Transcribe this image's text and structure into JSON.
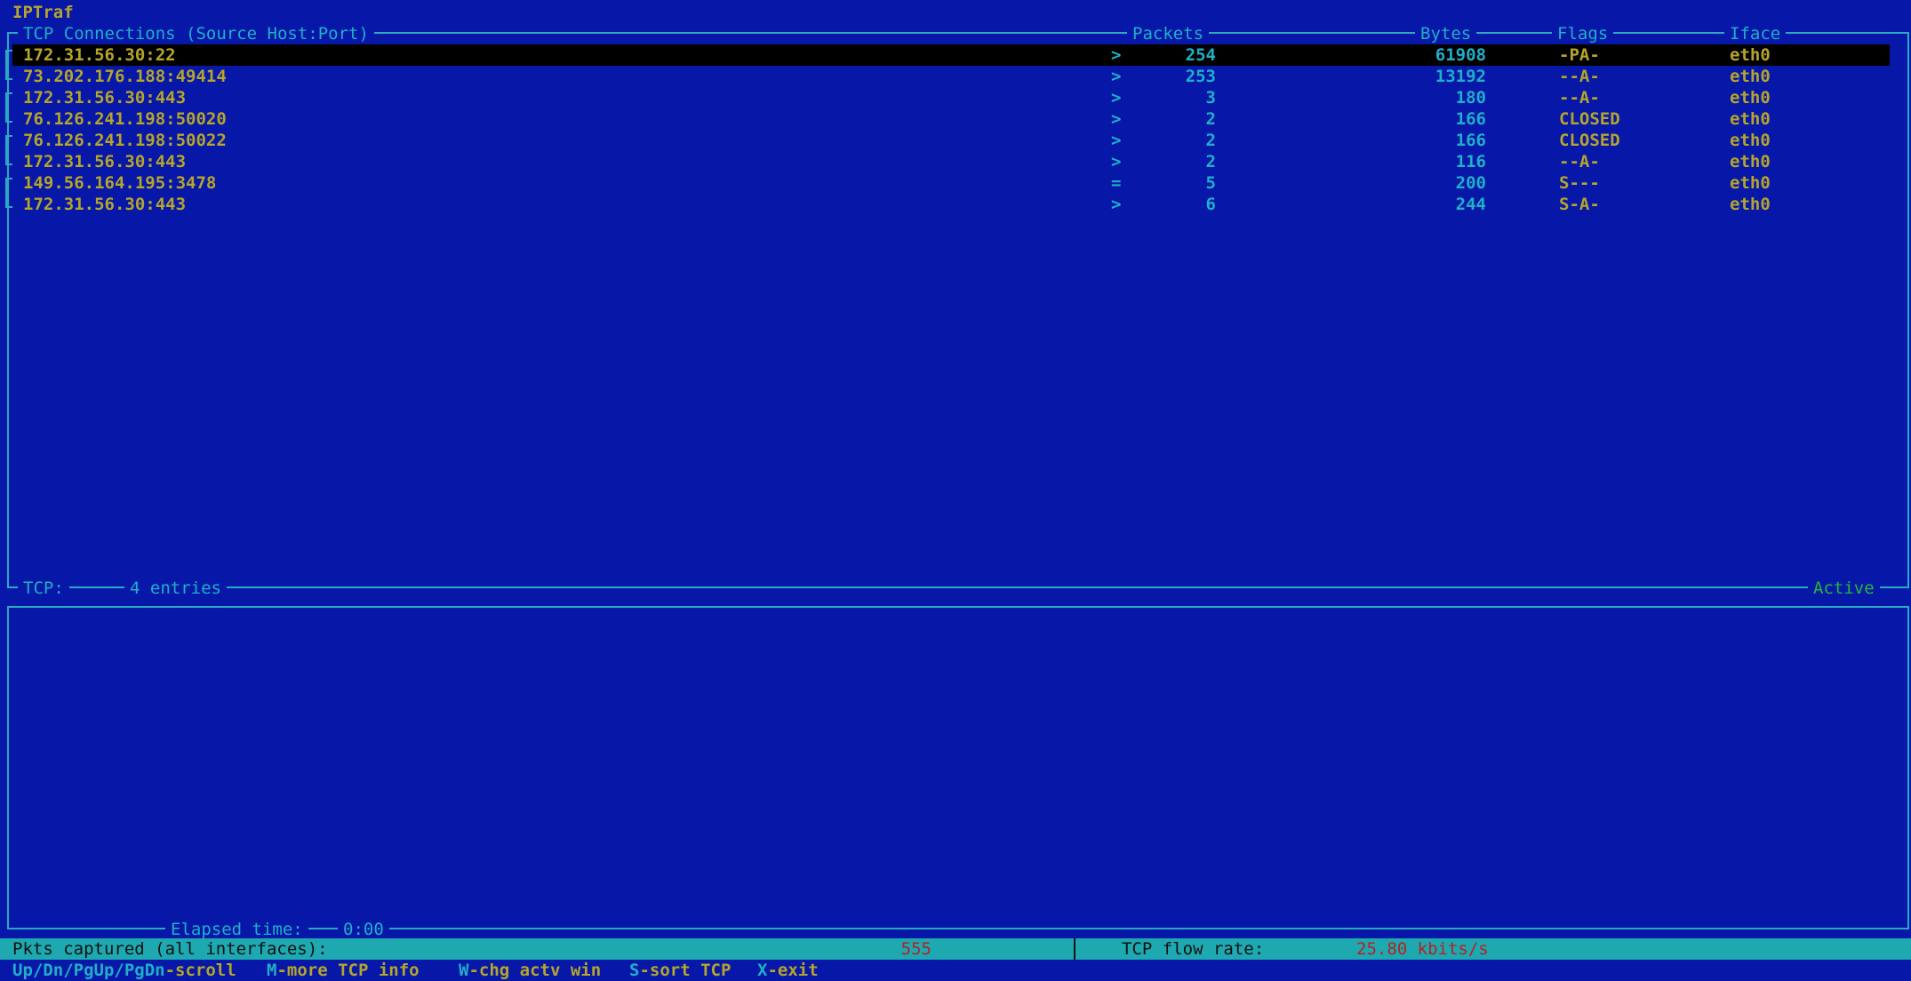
{
  "app": {
    "title": "IPTraf"
  },
  "tcp_window": {
    "title": "TCP Connections (Source Host:Port)",
    "columns": {
      "packets": "Packets",
      "bytes": "Bytes",
      "flags": "Flags",
      "iface": "Iface"
    },
    "rows": [
      {
        "host": "172.31.56.30:22",
        "dir": ">",
        "packets": "254",
        "bytes": "61908",
        "flags": "-PA-",
        "iface": "eth0"
      },
      {
        "host": "73.202.176.188:49414",
        "dir": ">",
        "packets": "253",
        "bytes": "13192",
        "flags": "--A-",
        "iface": "eth0"
      },
      {
        "host": "172.31.56.30:443",
        "dir": ">",
        "packets": "3",
        "bytes": "180",
        "flags": "--A-",
        "iface": "eth0"
      },
      {
        "host": "76.126.241.198:50020",
        "dir": ">",
        "packets": "2",
        "bytes": "166",
        "flags": "CLOSED",
        "iface": "eth0"
      },
      {
        "host": "76.126.241.198:50022",
        "dir": ">",
        "packets": "2",
        "bytes": "166",
        "flags": "CLOSED",
        "iface": "eth0"
      },
      {
        "host": "172.31.56.30:443",
        "dir": ">",
        "packets": "2",
        "bytes": "116",
        "flags": "--A-",
        "iface": "eth0"
      },
      {
        "host": "149.56.164.195:3478",
        "dir": "=",
        "packets": "5",
        "bytes": "200",
        "flags": "S---",
        "iface": "eth0"
      },
      {
        "host": "172.31.56.30:443",
        "dir": ">",
        "packets": "6",
        "bytes": "244",
        "flags": "S-A-",
        "iface": "eth0"
      }
    ],
    "footer": {
      "label": "TCP:",
      "entries": "4 entries",
      "status": "Active"
    }
  },
  "other_window": {
    "elapsed_label": "Elapsed time:",
    "elapsed_value": "0:00"
  },
  "status": {
    "pkts_label": "Pkts captured (all interfaces):",
    "pkts_value": "555",
    "flow_label": "TCP flow rate:",
    "flow_value": "25.80 kbits/s"
  },
  "keys": [
    {
      "key": "Up/Dn/PgUp/PgDn",
      "action": "-scroll"
    },
    {
      "key": "M",
      "action": "-more TCP info"
    },
    {
      "key": "W",
      "action": "-chg actv win"
    },
    {
      "key": "S",
      "action": "-sort TCP"
    },
    {
      "key": "X",
      "action": "-exit"
    }
  ],
  "colors": {
    "background": "#0717a8",
    "yellow_text": "#b5a52a",
    "cyan_text": "#1fb0c8",
    "active_green": "#23b83a",
    "status_bar": "#1ea8b0",
    "status_value_red": "#b42222"
  }
}
